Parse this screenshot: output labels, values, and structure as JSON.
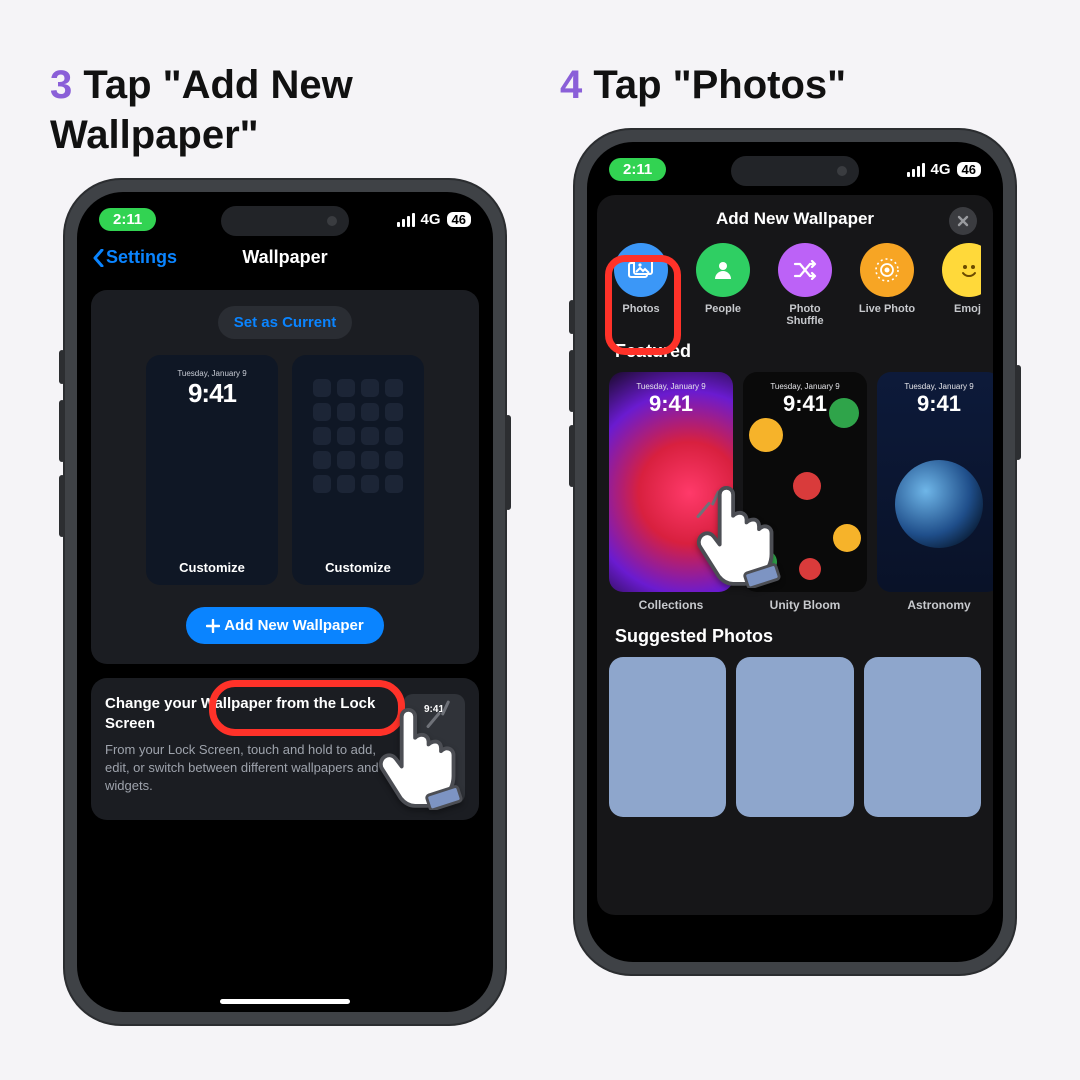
{
  "step3": {
    "num": "3",
    "pre": " Tap ",
    "bold": "\"Add New Wallpaper\""
  },
  "step4": {
    "num": "4",
    "pre": " Tap ",
    "bold": "\"Photos\""
  },
  "status": {
    "time": "2:11",
    "net": "4G",
    "batt": "46"
  },
  "p1": {
    "back": "Settings",
    "title": "Wallpaper",
    "set_current": "Set as Current",
    "prev_date": "Tuesday, January 9",
    "prev_time": "9:41",
    "customize": "Customize",
    "add_btn": "Add New Wallpaper",
    "info_title": "Change your Wallpaper from the Lock Screen",
    "info_body": "From your Lock Screen, touch and hold to add, edit, or switch between different wallpapers and widgets.",
    "info_time": "9:41"
  },
  "p2": {
    "panel_title": "Add New Wallpaper",
    "cats": [
      {
        "label": "Photos"
      },
      {
        "label": "People"
      },
      {
        "label": "Photo Shuffle"
      },
      {
        "label": "Live Photo"
      },
      {
        "label": "Emoji"
      }
    ],
    "featured": "Featured",
    "feat_date": "Tuesday, January 9",
    "feat_time": "9:41",
    "feat_labels": [
      "Collections",
      "Unity Bloom",
      "Astronomy"
    ],
    "suggested": "Suggested Photos"
  }
}
